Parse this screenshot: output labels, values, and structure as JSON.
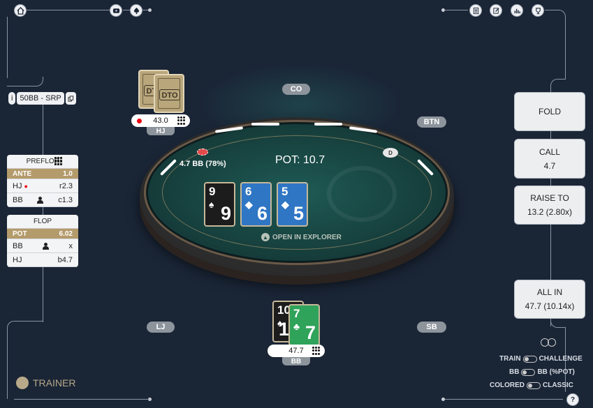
{
  "top_bar": {
    "home_icon": "home-icon",
    "video_icon": "video-icon",
    "spade_icon": "spade-icon",
    "right_icons": [
      "notes-icon",
      "edit-icon",
      "chart-icon",
      "trophy-icon"
    ]
  },
  "spot": {
    "info": "i",
    "label": "50BB - SRP"
  },
  "positions": {
    "co": "CO",
    "btn": "BTN",
    "lj": "LJ",
    "sb": "SB"
  },
  "table": {
    "pot": "POT: 10.7",
    "bet": "4.7 BB (78%)",
    "dealer": "D",
    "explorer": "OPEN IN EXPLORER",
    "board": [
      {
        "rank": "9",
        "suit": "♠",
        "color": "#1c1c1c"
      },
      {
        "rank": "6",
        "suit": "◆",
        "color": "#2f76c4"
      },
      {
        "rank": "5",
        "suit": "◆",
        "color": "#2f76c4"
      }
    ]
  },
  "villain": {
    "stack": "43.0",
    "position": "HJ",
    "card_logo": "DTO"
  },
  "hero": {
    "stack": "47.7",
    "position": "BB",
    "cards": [
      {
        "rank": "10",
        "suit": "♠",
        "color": "#1c1c1c"
      },
      {
        "rank": "7",
        "suit": "♣",
        "color": "#2fa35a"
      }
    ]
  },
  "history": {
    "preflop": {
      "title": "PREFLOP",
      "ante_label": "ANTE",
      "ante_value": "1.0",
      "rows": [
        {
          "player": "HJ",
          "action": "r2.3"
        },
        {
          "player": "BB",
          "action": "c1.3"
        }
      ]
    },
    "flop": {
      "title": "FLOP",
      "pot_label": "POT",
      "pot_value": "6.02",
      "rows": [
        {
          "player": "BB",
          "action": "x"
        },
        {
          "player": "HJ",
          "action": "b4.7"
        }
      ]
    }
  },
  "actions": {
    "fold": "FOLD",
    "call_label": "CALL",
    "call_value": "4.7",
    "raise_label": "RAISE TO",
    "raise_value": "13.2 (2.80x)",
    "allin_label": "ALL IN",
    "allin_value": "47.7 (10.14x)"
  },
  "settings": {
    "train": "TRAIN",
    "challenge": "CHALLENGE",
    "bb": "BB",
    "bb_pot": "BB (%POT)",
    "colored": "COLORED",
    "classic": "CLASSIC"
  },
  "trainer_label": "TRAINER",
  "help": "?"
}
